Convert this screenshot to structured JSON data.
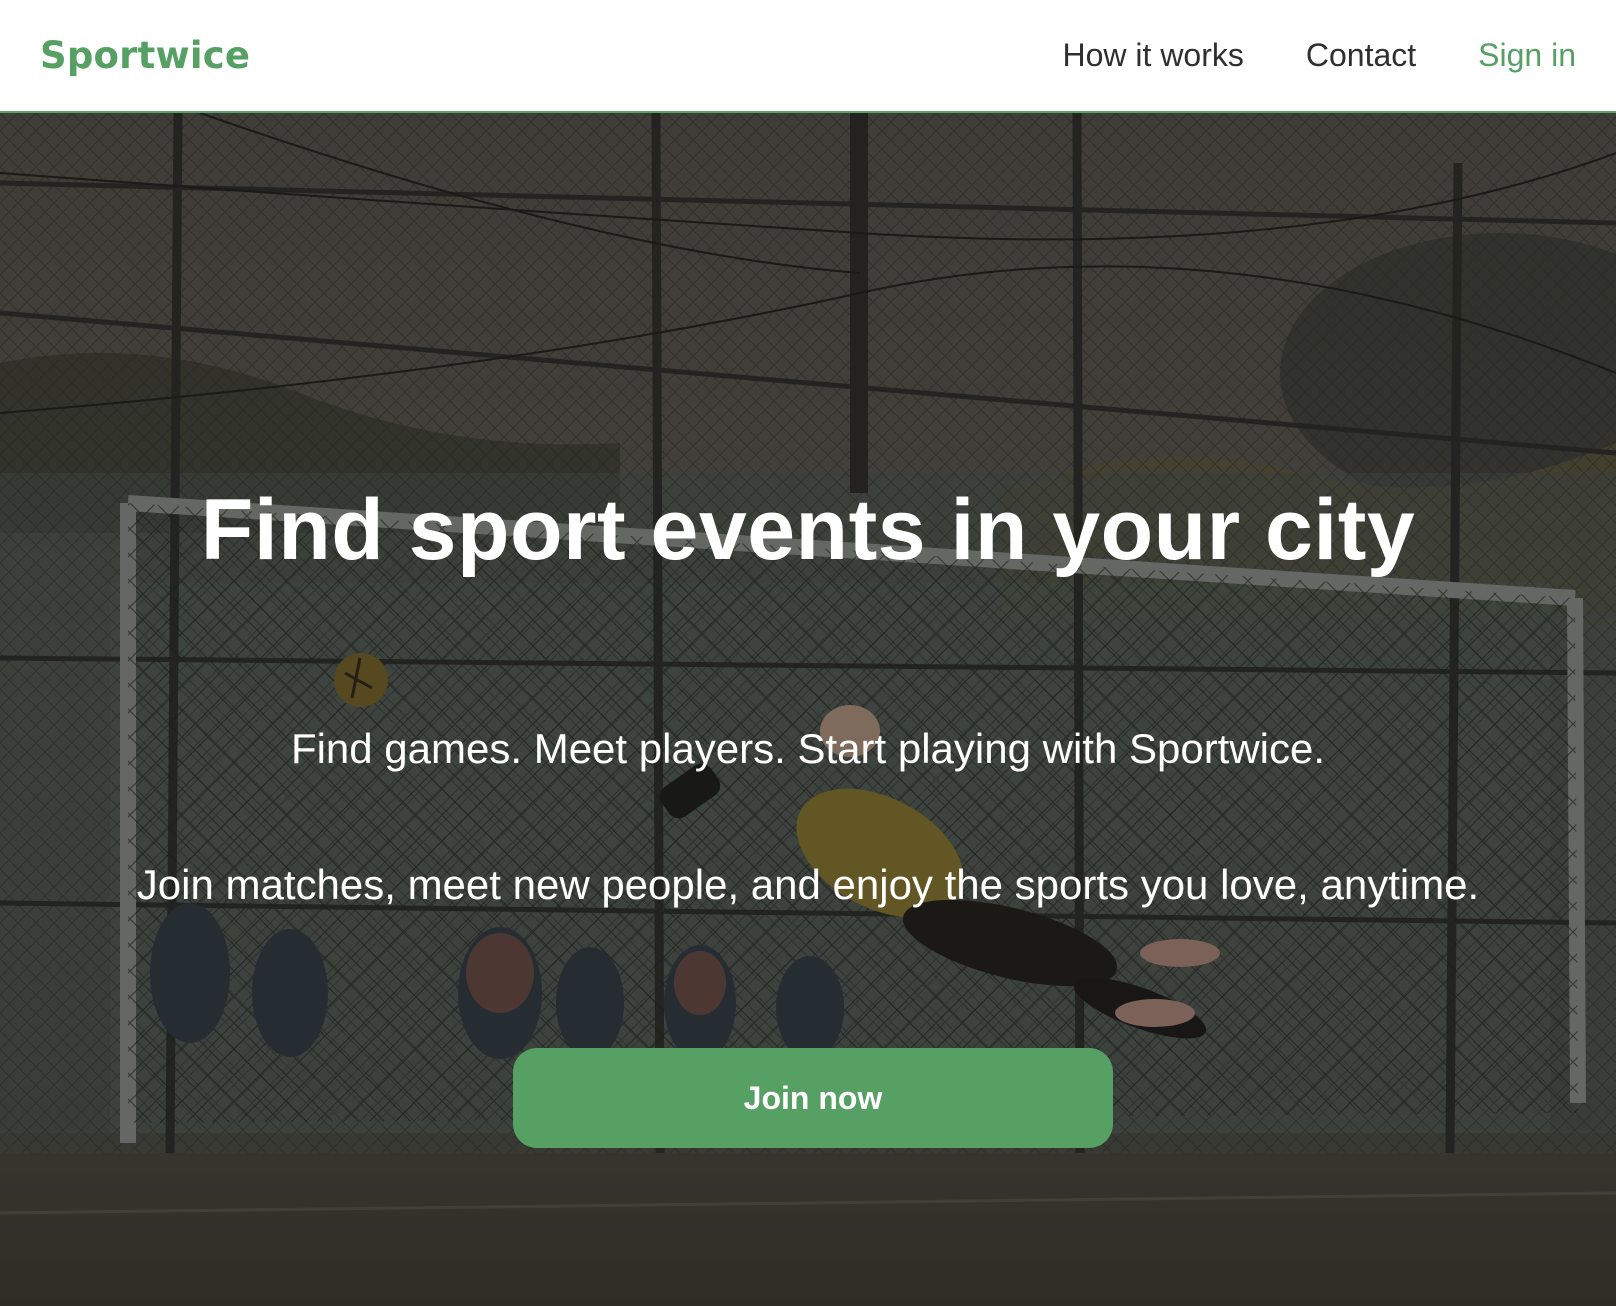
{
  "navbar": {
    "brand": "Sportwice",
    "links": {
      "how_it_works": "How it works",
      "contact": "Contact",
      "sign_in": "Sign in"
    }
  },
  "hero": {
    "title": "Find sport events in your city",
    "tagline": "Find games. Meet players. Start playing with Sportwice.",
    "description": "Join matches, meet new people, and enjoy the sports you love, anytime.",
    "cta_label": "Join now"
  },
  "colors": {
    "accent": "#56a064",
    "nav_text": "#2f2f2f",
    "hero_text": "#ffffff"
  }
}
